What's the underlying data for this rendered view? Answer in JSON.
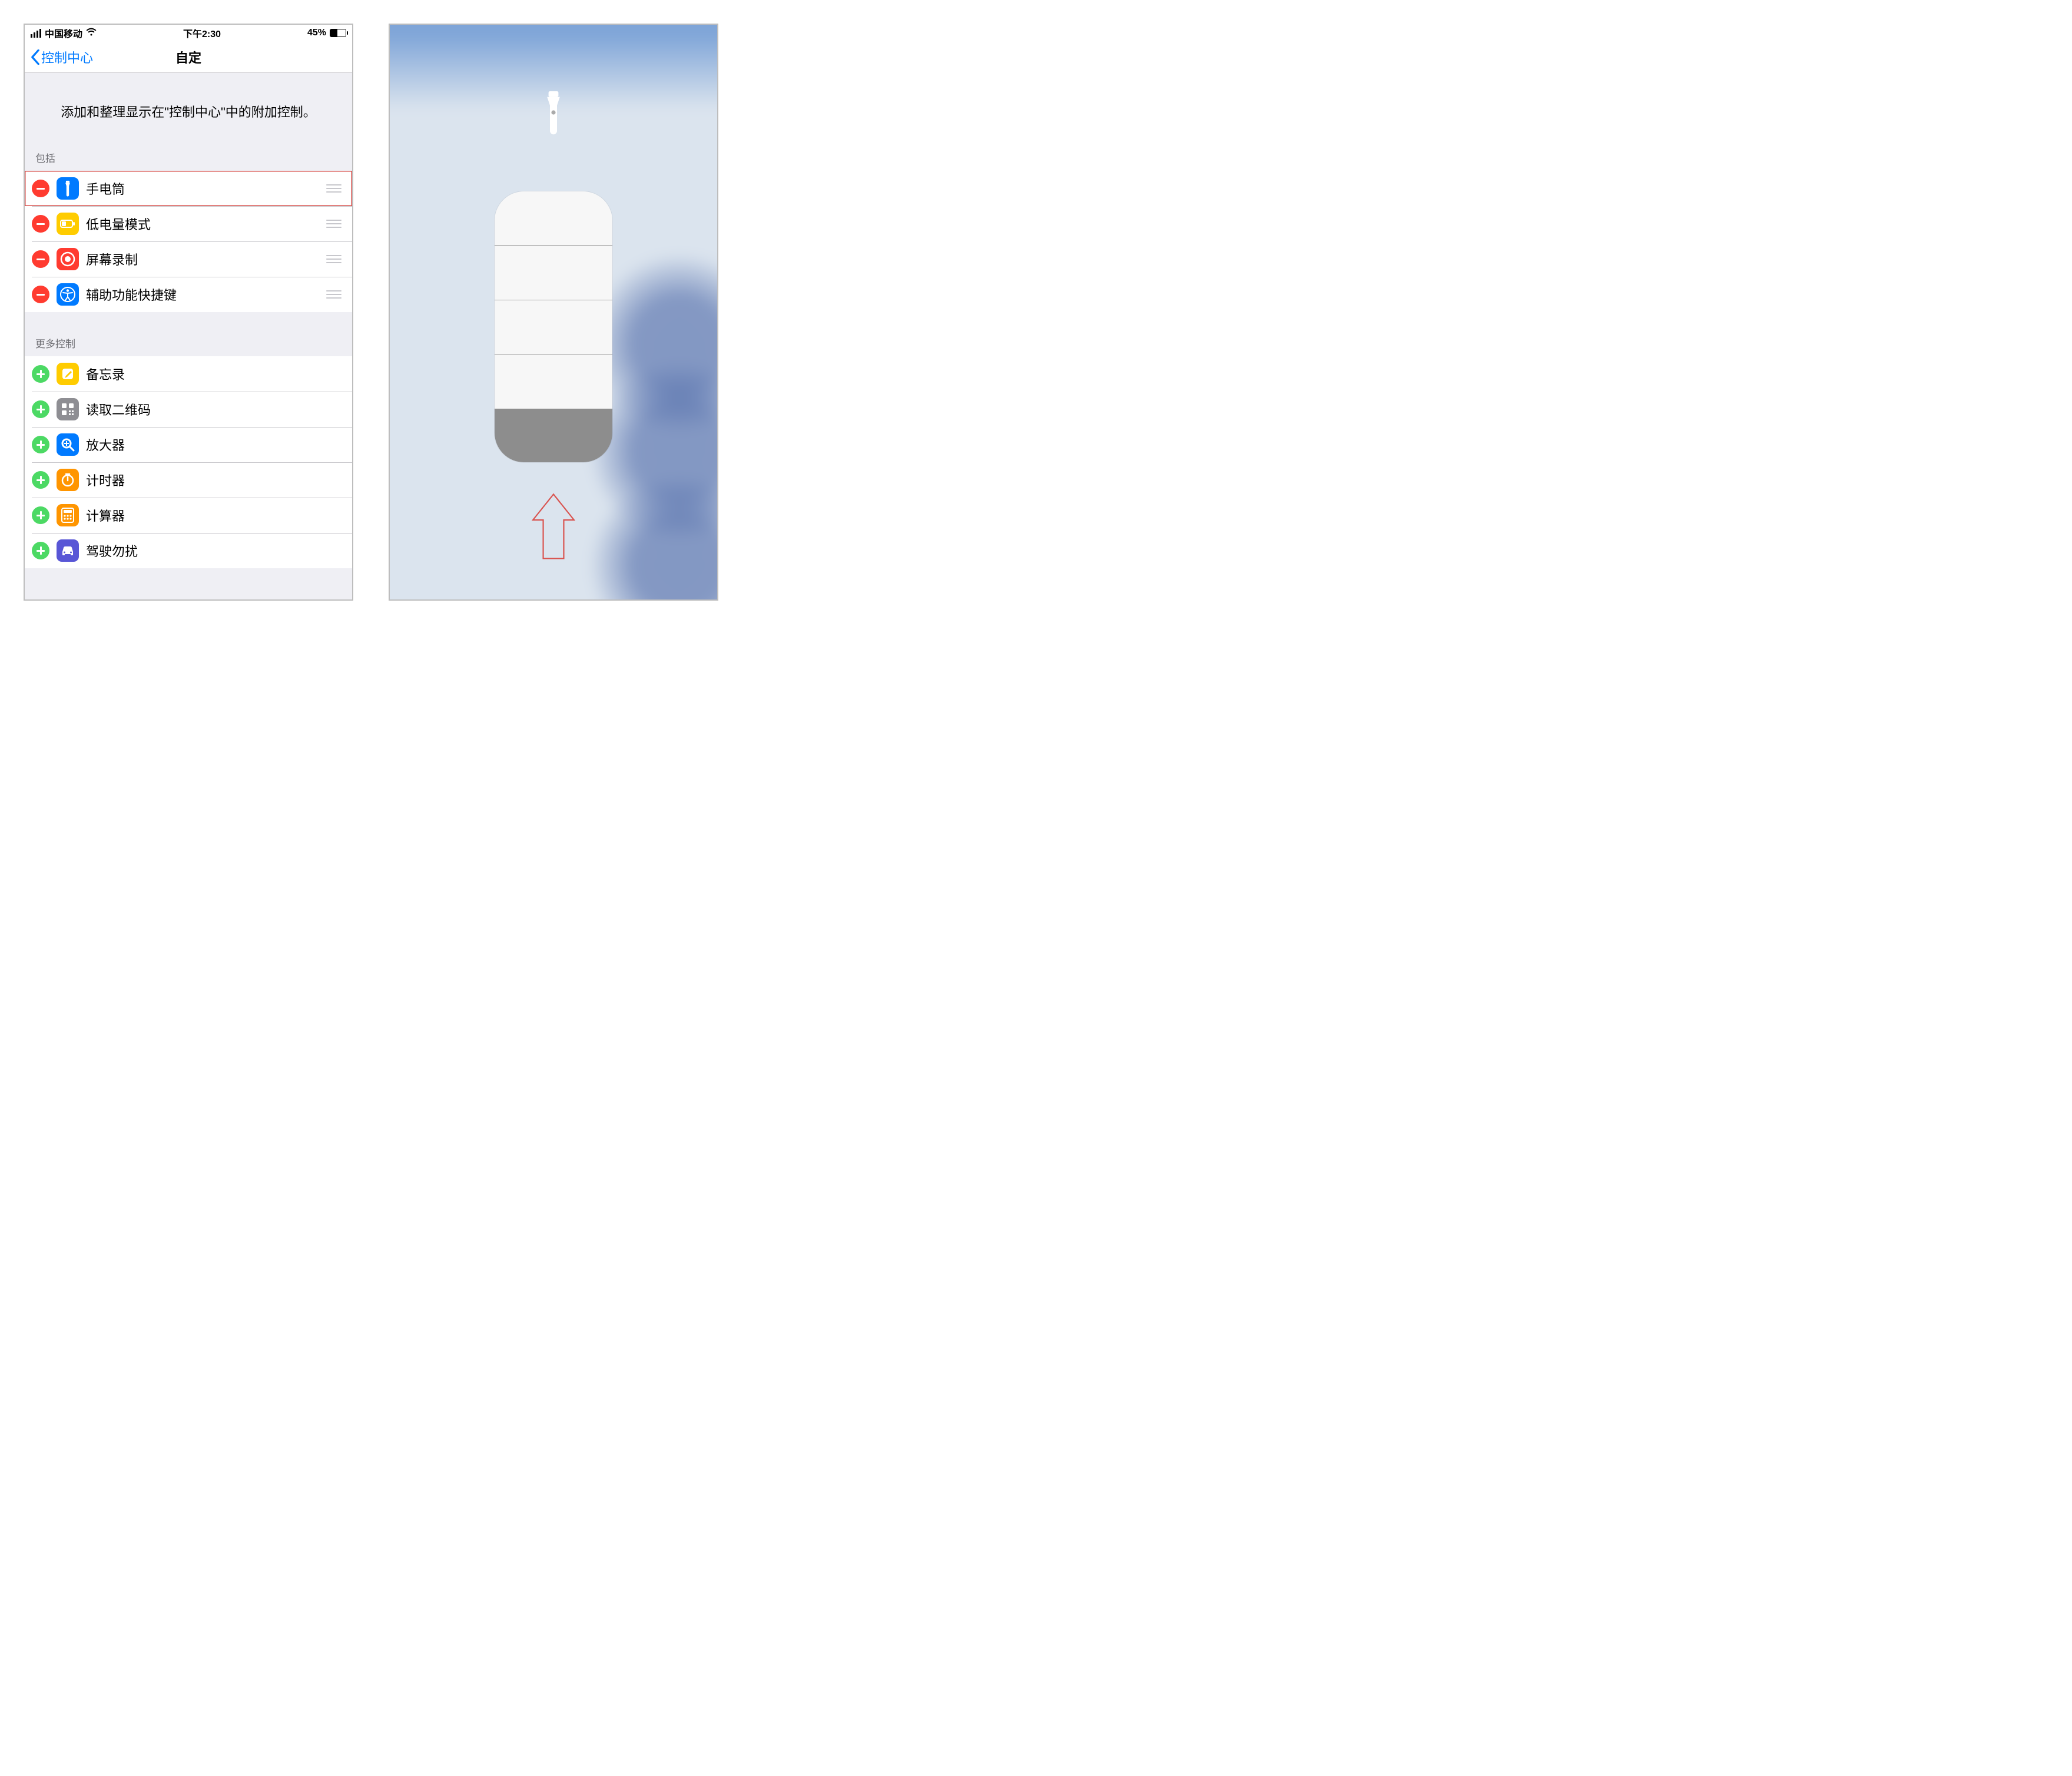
{
  "status": {
    "carrier": "中国移动",
    "time": "下午2:30",
    "battery_text": "45%",
    "battery_percent": 45
  },
  "nav": {
    "back_label": "控制中心",
    "title": "自定"
  },
  "intro_text": "添加和整理显示在\"控制中心\"中的附加控制。",
  "sections": {
    "included_header": "包括",
    "more_header": "更多控制"
  },
  "included": [
    {
      "label": "手电筒",
      "icon": "flashlight-icon",
      "color": "ic-blue",
      "highlight": true
    },
    {
      "label": "低电量模式",
      "icon": "battery-low-icon",
      "color": "ic-yellow",
      "highlight": false
    },
    {
      "label": "屏幕录制",
      "icon": "record-icon",
      "color": "ic-red",
      "highlight": false
    },
    {
      "label": "辅助功能快捷键",
      "icon": "accessibility-icon",
      "color": "ic-blue",
      "highlight": false
    }
  ],
  "more": [
    {
      "label": "备忘录",
      "icon": "notes-icon",
      "color": "ic-yellow"
    },
    {
      "label": "读取二维码",
      "icon": "qrcode-icon",
      "color": "ic-gray"
    },
    {
      "label": "放大器",
      "icon": "magnifier-icon",
      "color": "ic-blue"
    },
    {
      "label": "计时器",
      "icon": "timer-icon",
      "color": "ic-orange"
    },
    {
      "label": "计算器",
      "icon": "calculator-icon",
      "color": "ic-orange"
    },
    {
      "label": "驾驶勿扰",
      "icon": "car-icon",
      "color": "ic-purple"
    }
  ],
  "flashlight_slider": {
    "segments_total": 5,
    "level": 4
  }
}
